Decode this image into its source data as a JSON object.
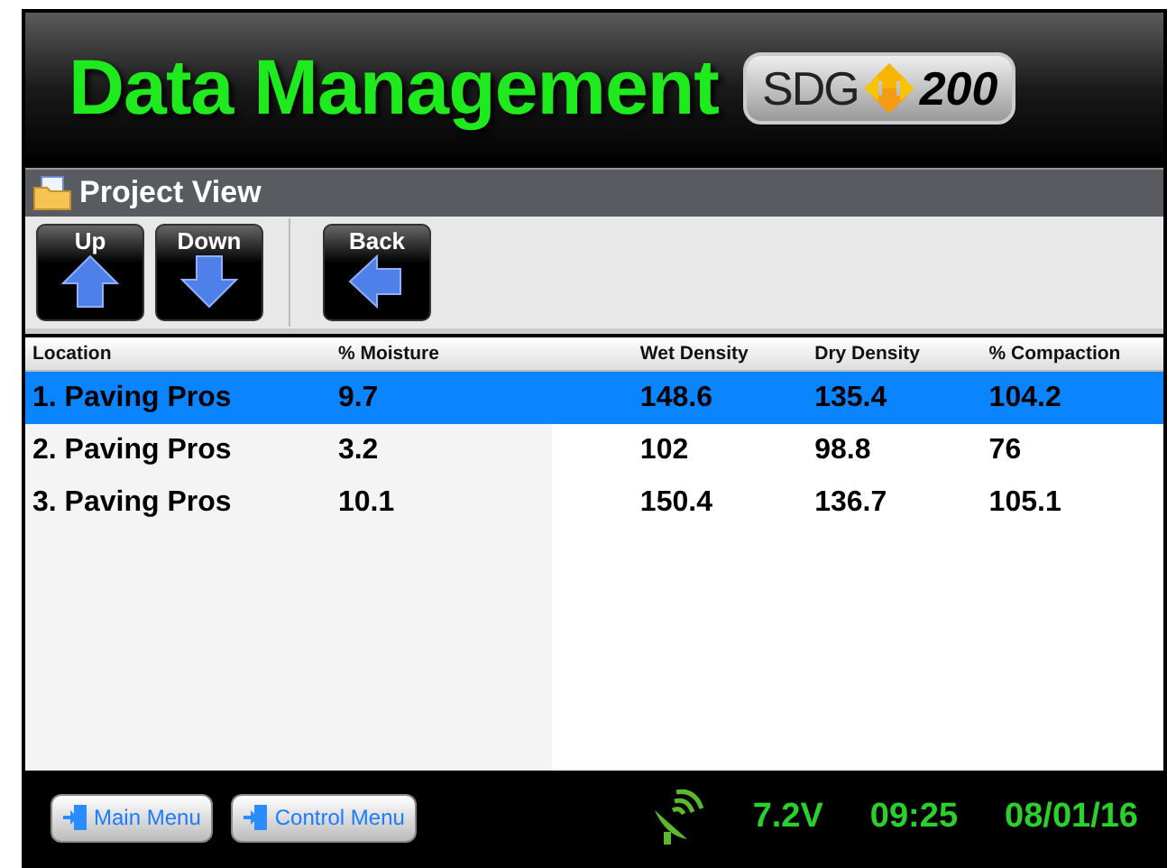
{
  "header": {
    "title": "Data Management",
    "logo": {
      "prefix": "SDG",
      "suffix": "200"
    }
  },
  "panel": {
    "title": "Project View"
  },
  "toolbar": [
    {
      "label": "Up",
      "kind": "up"
    },
    {
      "label": "Down",
      "kind": "down"
    },
    {
      "label": "Back",
      "kind": "back"
    }
  ],
  "table": {
    "columns": [
      "Location",
      "% Moisture",
      "Wet Density",
      "Dry Density",
      "% Compaction"
    ],
    "rows": [
      {
        "selected": true,
        "cells": [
          "1. Paving Pros",
          "9.7",
          "148.6",
          "135.4",
          "104.2"
        ]
      },
      {
        "selected": false,
        "cells": [
          "2. Paving Pros",
          "3.2",
          "102",
          "98.8",
          "76"
        ]
      },
      {
        "selected": false,
        "cells": [
          "3. Paving Pros",
          "10.1",
          "150.4",
          "136.7",
          "105.1"
        ]
      }
    ]
  },
  "status_bar": {
    "buttons": [
      "Main Menu",
      "Control Menu"
    ],
    "voltage": "7.2V",
    "time": "09:25",
    "date": "08/01/16"
  }
}
